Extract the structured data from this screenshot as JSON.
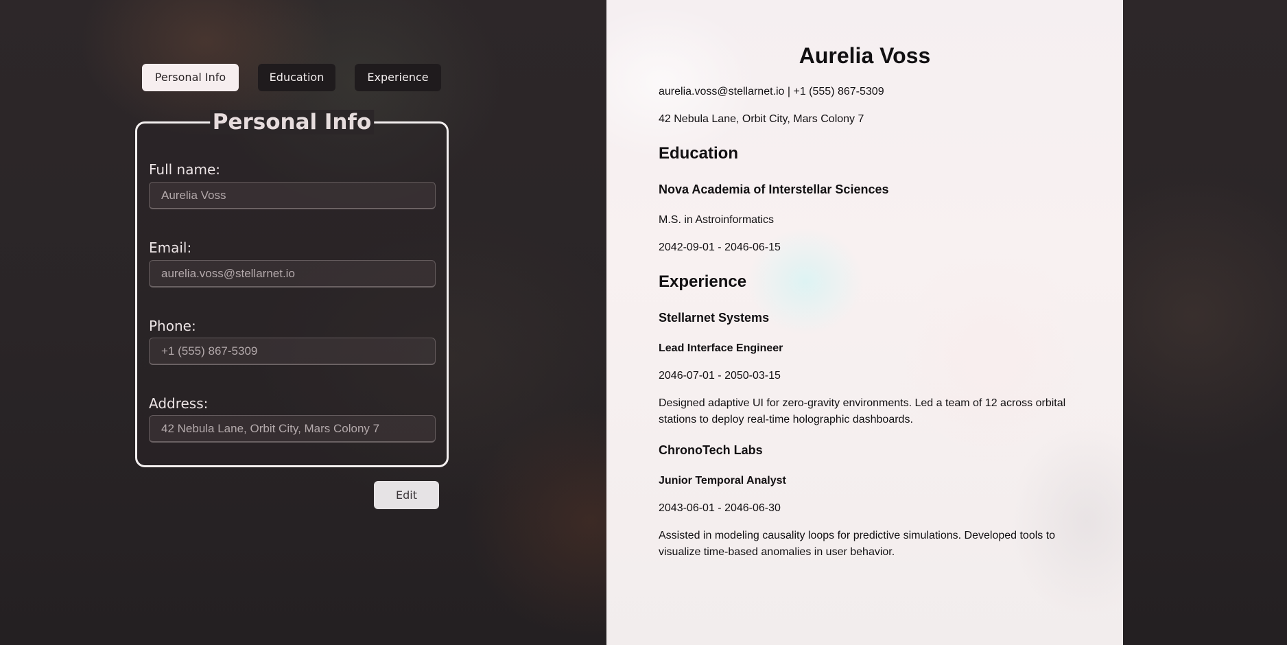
{
  "tabs": [
    {
      "label": "Personal Info",
      "active": true
    },
    {
      "label": "Education",
      "active": false
    },
    {
      "label": "Experience",
      "active": false
    }
  ],
  "form": {
    "legend": "Personal Info",
    "full_name": {
      "label": "Full name:",
      "value": "Aurelia Voss"
    },
    "email": {
      "label": "Email:",
      "value": "aurelia.voss@stellarnet.io"
    },
    "phone": {
      "label": "Phone:",
      "value": "+1 (555) 867-5309"
    },
    "address": {
      "label": "Address:",
      "value": "42 Nebula Lane, Orbit City, Mars Colony 7"
    },
    "edit_label": "Edit"
  },
  "preview": {
    "name": "Aurelia Voss",
    "contact": "aurelia.voss@stellarnet.io | +1 (555) 867-5309",
    "address": "42 Nebula Lane, Orbit City, Mars Colony 7",
    "education_heading": "Education",
    "education": {
      "school": "Nova Academia of Interstellar Sciences",
      "degree": "M.S. in Astroinformatics",
      "dates": "2042-09-01 - 2046-06-15"
    },
    "experience_heading": "Experience",
    "experience": [
      {
        "company": "Stellarnet Systems",
        "role": "Lead Interface Engineer",
        "dates": "2046-07-01 - 2050-03-15",
        "description": "Designed adaptive UI for zero-gravity environments. Led a team of 12 across orbital stations to deploy real-time holographic dashboards."
      },
      {
        "company": "ChronoTech Labs",
        "role": "Junior Temporal Analyst",
        "dates": "2043-06-01 - 2046-06-30",
        "description": "Assisted in modeling causality loops for predictive simulations. Developed tools to visualize time-based anomalies in user behavior."
      }
    ]
  },
  "colors": {
    "background": "#2a2527",
    "preview_background": "#f5eff1",
    "active_tab": "#f6eeef",
    "inactive_tab": "#1f1b1d",
    "edit_button": "#e6e3e5"
  }
}
